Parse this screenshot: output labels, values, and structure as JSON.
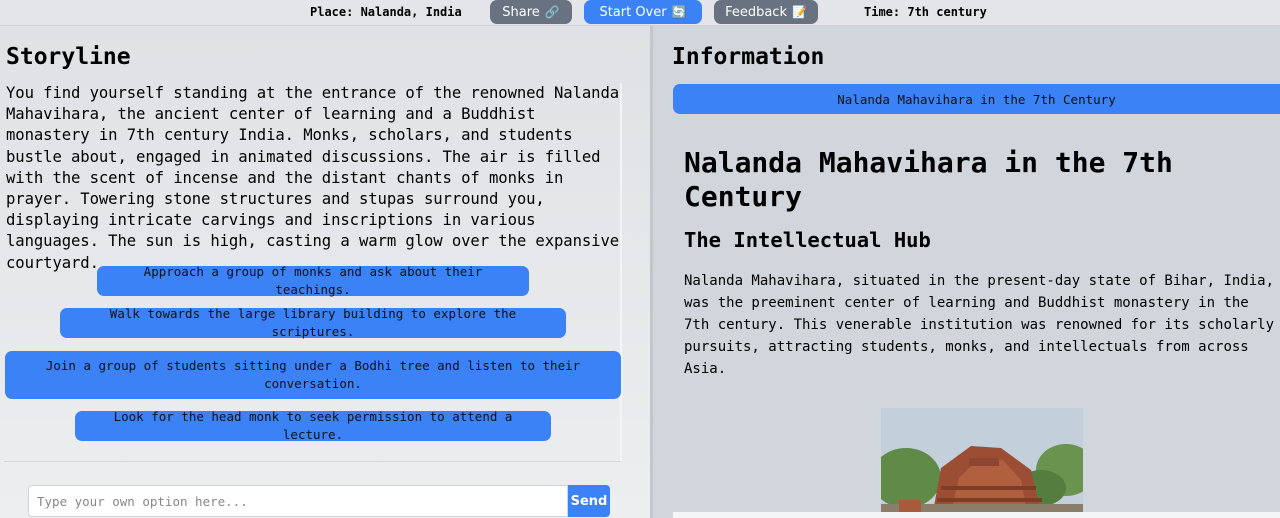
{
  "header": {
    "place": "Place: Nalanda, India",
    "time": "Time: 7th century",
    "share_label": "Share",
    "share_icon": "link-icon",
    "start_over_label": "Start Over",
    "start_over_icon": "refresh-icon",
    "feedback_label": "Feedback",
    "feedback_icon": "memo-icon"
  },
  "storyline": {
    "heading": "Storyline",
    "text": "You find yourself standing at the entrance of the renowned Nalanda Mahavihara, the ancient center of learning and a Buddhist monastery in 7th century India. Monks, scholars, and students bustle about, engaged in animated discussions. The air is filled with the scent of incense and the distant chants of monks in prayer. Towering stone structures and stupas surround you, displaying intricate carvings and inscriptions in various languages. The sun is high, casting a warm glow over the expansive courtyard.",
    "options": [
      "Approach a group of monks and ask about their teachings.",
      "Walk towards the large library building to explore the scriptures.",
      "Join a group of students sitting under a Bodhi tree and listen to their conversation.",
      "Look for the head monk to seek permission to attend a lecture."
    ],
    "input_placeholder": "Type your own option here...",
    "input_value": "",
    "send_label": "Send"
  },
  "information": {
    "heading": "Information",
    "tab_label": "Nalanda Mahavihara in the 7th Century",
    "article_title": "Nalanda Mahavihara in the 7th Century",
    "article_subtitle": "The Intellectual Hub",
    "article_body": "Nalanda Mahavihara, situated in the present-day state of Bihar, India, was the preeminent center of learning and Buddhist monastery in the 7th century. This venerable institution was renowned for its scholarly pursuits, attracting students, monks, and intellectuals from across Asia."
  },
  "colors": {
    "accent": "#3b82f6",
    "muted_button": "#697281"
  }
}
